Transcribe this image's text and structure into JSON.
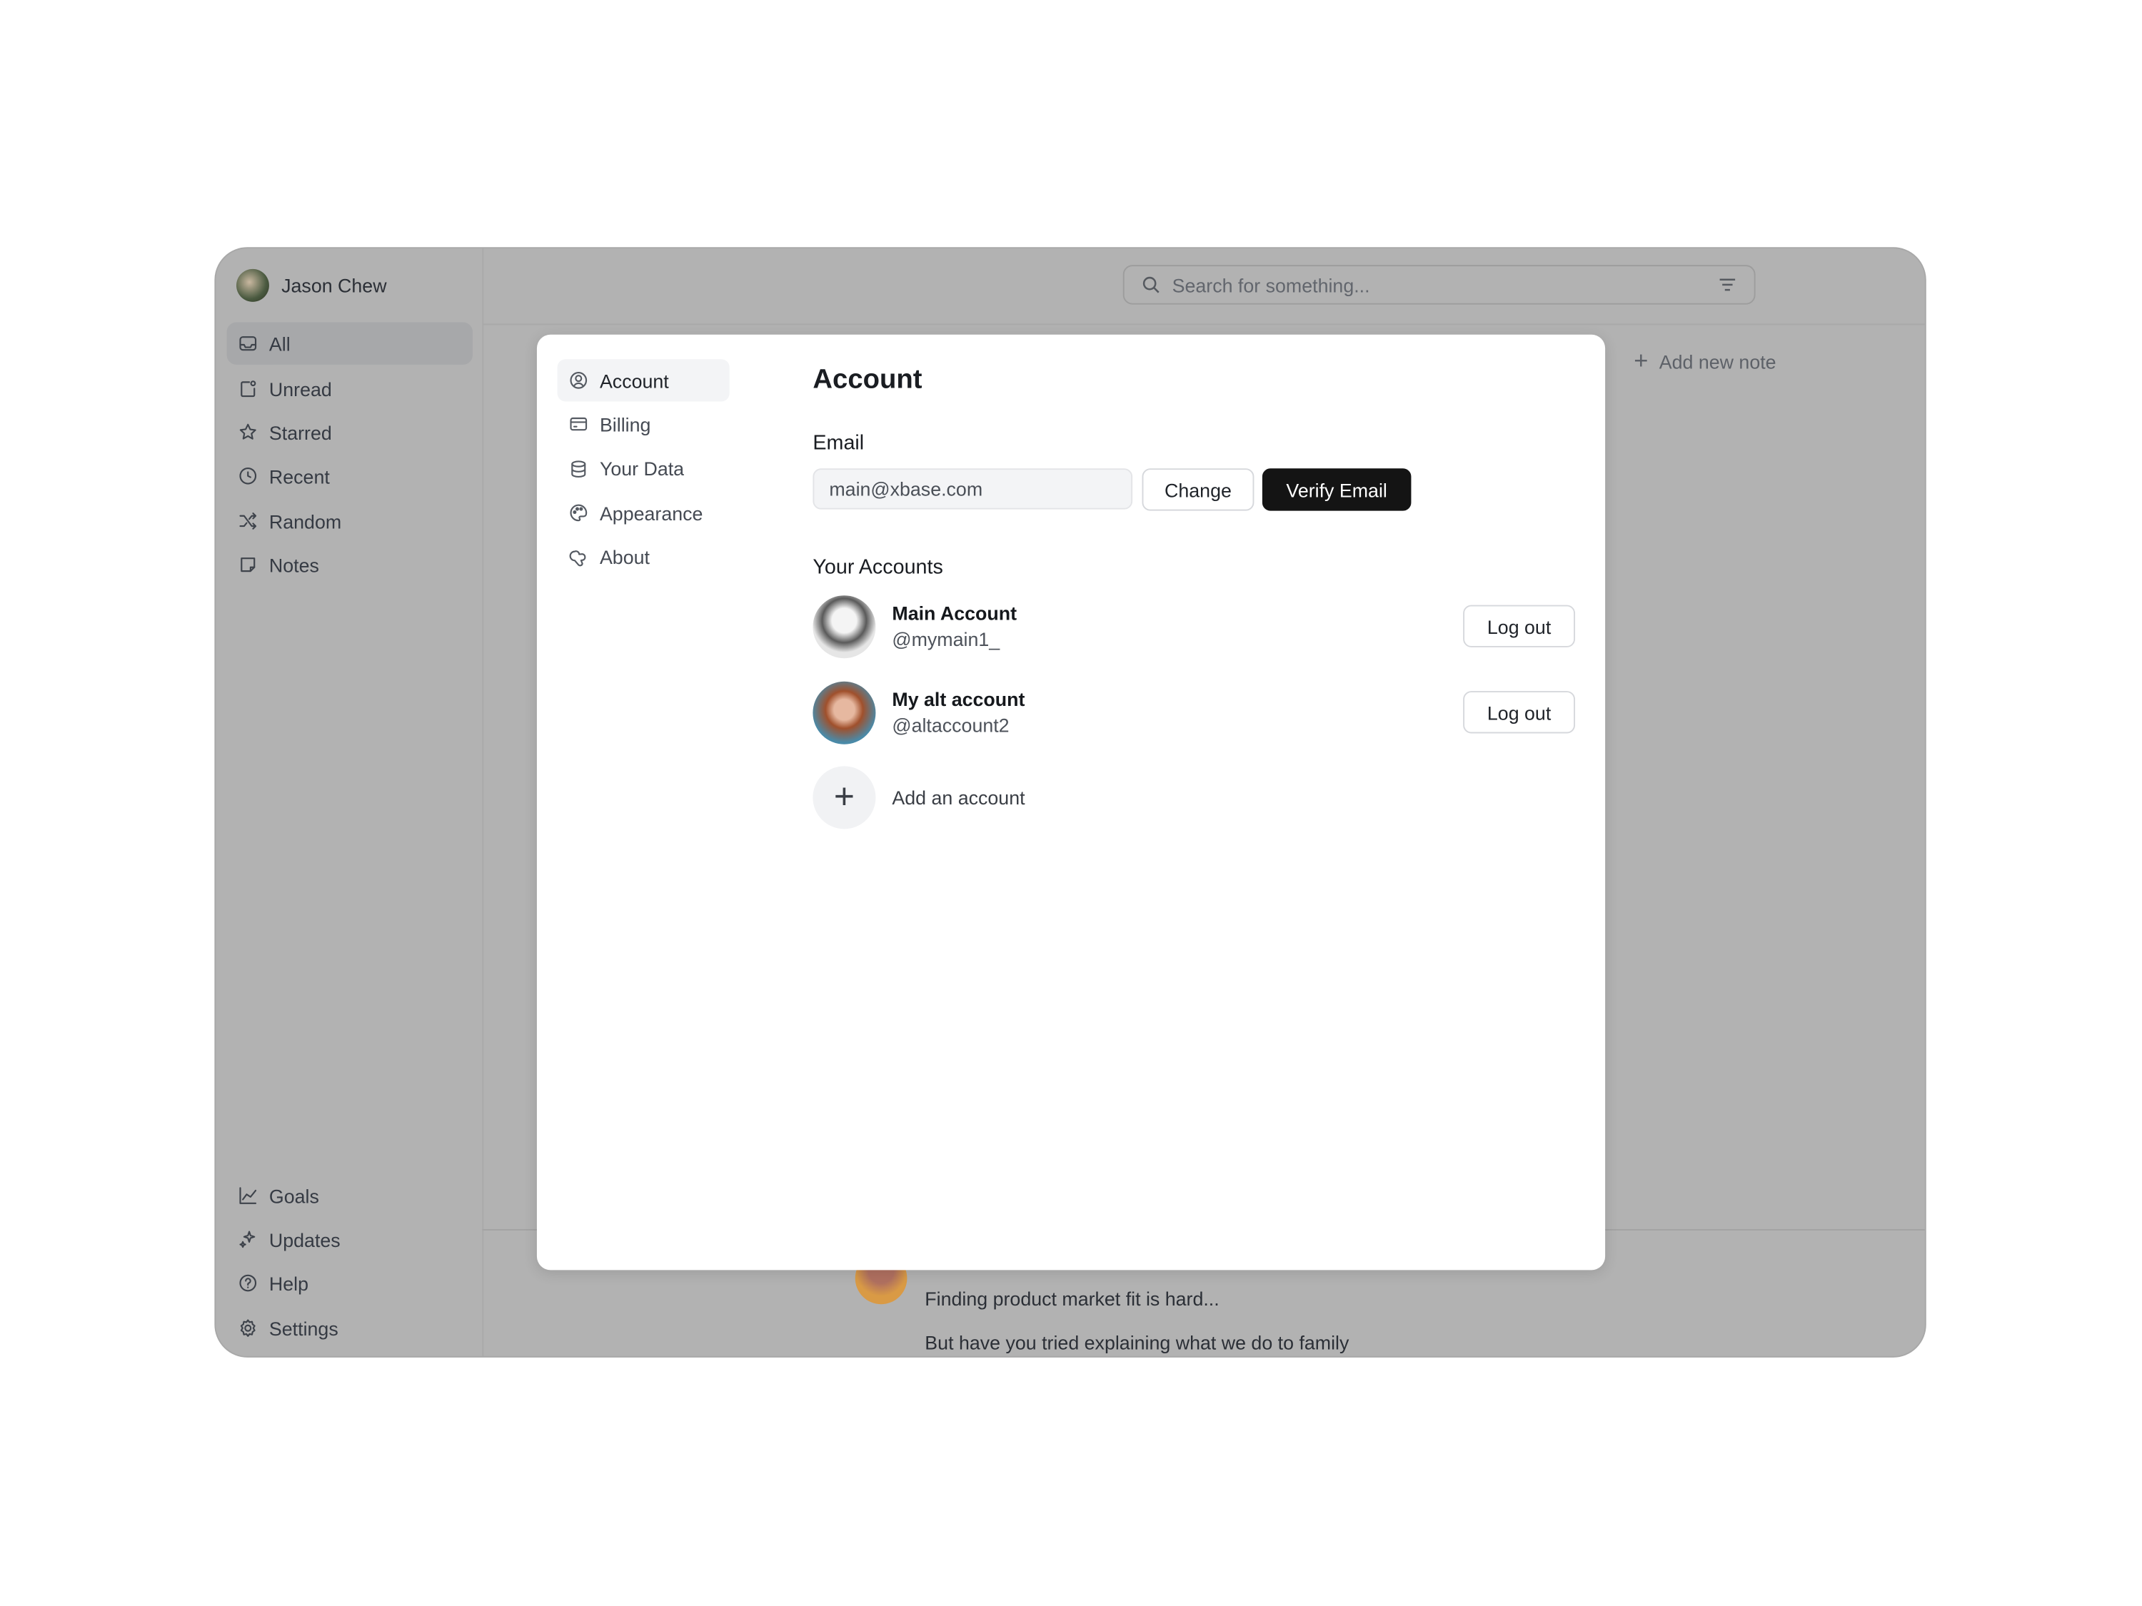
{
  "sidebar": {
    "user_name": "Jason Chew",
    "items": [
      {
        "label": "All",
        "icon": "inbox-icon"
      },
      {
        "label": "Unread",
        "icon": "unread-icon"
      },
      {
        "label": "Starred",
        "icon": "star-icon"
      },
      {
        "label": "Recent",
        "icon": "clock-icon"
      },
      {
        "label": "Random",
        "icon": "shuffle-icon"
      },
      {
        "label": "Notes",
        "icon": "note-icon"
      }
    ],
    "bottom_items": [
      {
        "label": "Goals",
        "icon": "chart-icon"
      },
      {
        "label": "Updates",
        "icon": "sparkle-icon"
      },
      {
        "label": "Help",
        "icon": "help-icon"
      },
      {
        "label": "Settings",
        "icon": "gear-icon"
      }
    ]
  },
  "search": {
    "placeholder": "Search for something..."
  },
  "add_note_label": "Add new note",
  "feed": {
    "line1": "Finding product market fit is hard...",
    "line2": "But have you tried explaining what we do to family"
  },
  "modal": {
    "nav": [
      {
        "label": "Account"
      },
      {
        "label": "Billing"
      },
      {
        "label": "Your Data"
      },
      {
        "label": "Appearance"
      },
      {
        "label": "About"
      }
    ],
    "title": "Account",
    "email_label": "Email",
    "email_value": "main@xbase.com",
    "change_label": "Change",
    "verify_label": "Verify Email",
    "accounts_label": "Your Accounts",
    "accounts": [
      {
        "name": "Main Account",
        "handle": "@mymain1_",
        "logout": "Log out"
      },
      {
        "name": "My alt account",
        "handle": "@altaccount2",
        "logout": "Log out"
      }
    ],
    "add_account_label": "Add an account"
  },
  "colors": {
    "overlay": "#b2b2b2",
    "primary_button": "#141414",
    "active_nav": "#f3f4f6"
  }
}
